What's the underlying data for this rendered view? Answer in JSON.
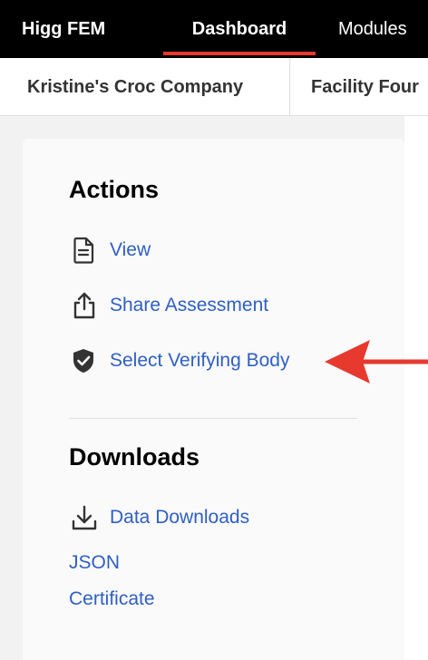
{
  "nav": {
    "brand": "Higg FEM",
    "tabs": [
      {
        "label": "Dashboard"
      },
      {
        "label": "Modules"
      }
    ]
  },
  "breadcrumb": {
    "company": "Kristine's Croc Company",
    "facility": "Facility Four"
  },
  "actions": {
    "title": "Actions",
    "items": [
      {
        "label": "View",
        "icon": "document-icon"
      },
      {
        "label": "Share Assessment",
        "icon": "share-icon"
      },
      {
        "label": "Select Verifying Body",
        "icon": "shield-check-icon"
      }
    ]
  },
  "downloads": {
    "title": "Downloads",
    "data_downloads": {
      "label": "Data Downloads",
      "icon": "download-icon"
    },
    "links": [
      {
        "label": "JSON"
      },
      {
        "label": "Certificate"
      }
    ]
  },
  "colors": {
    "nav_bg": "#000000",
    "accent_red": "#e8392e",
    "link_blue": "#2f5fc4"
  }
}
